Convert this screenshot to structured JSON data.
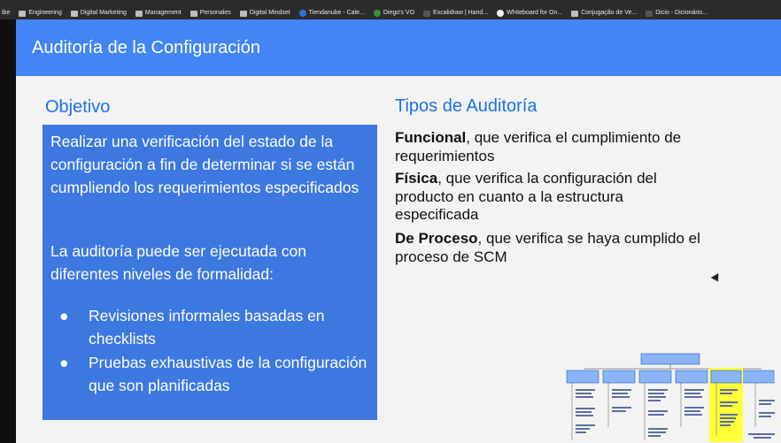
{
  "bookmarks": [
    {
      "label": "ibe",
      "icon": "folder-icon"
    },
    {
      "label": "Engineering",
      "icon": "folder-icon"
    },
    {
      "label": "Digital Marketing",
      "icon": "folder-icon"
    },
    {
      "label": "Management",
      "icon": "folder-icon"
    },
    {
      "label": "Personales",
      "icon": "folder-icon"
    },
    {
      "label": "Digital Mindset",
      "icon": "folder-icon"
    },
    {
      "label": "Tiendanube - Cale...",
      "icon": "site-icon"
    },
    {
      "label": "Diego's VO",
      "icon": "site-icon"
    },
    {
      "label": "Excalidraw | Hand...",
      "icon": "site-icon"
    },
    {
      "label": "Whiteboard for On...",
      "icon": "site-icon"
    },
    {
      "label": "Conjugação de Ve...",
      "icon": "site-icon"
    },
    {
      "label": "Dicio - Dicionário...",
      "icon": "site-icon"
    }
  ],
  "slide": {
    "title": "Auditoría de la Configuración",
    "objetivo_heading": "Objetivo",
    "objetivo_p1": "Realizar una verificación del estado de la configuración a fin de determinar si se están cumpliendo los requerimientos especificados",
    "objetivo_p2": "La auditoría puede ser ejecutada con diferentes niveles de formalidad:",
    "bullets": [
      "Revisiones informales basadas en checklists",
      "Pruebas exhaustivas de la configuración que son planificadas"
    ],
    "tipos_heading": "Tipos de Auditoría",
    "tipos": [
      {
        "bold": "Funcional",
        "rest": ", que verifica el cumplimiento de requerimientos"
      },
      {
        "bold": "Física",
        "rest": ", que verifica la configuración del producto en cuanto a la estructura especificada"
      },
      {
        "bold": "De Proceso",
        "rest": ", que verifica se haya cumplido el proceso de SCM"
      }
    ]
  },
  "colors": {
    "header": "#4285f4",
    "box": "#3c78e0",
    "heading_text": "#1a73e8",
    "highlight": "#ffff00"
  }
}
